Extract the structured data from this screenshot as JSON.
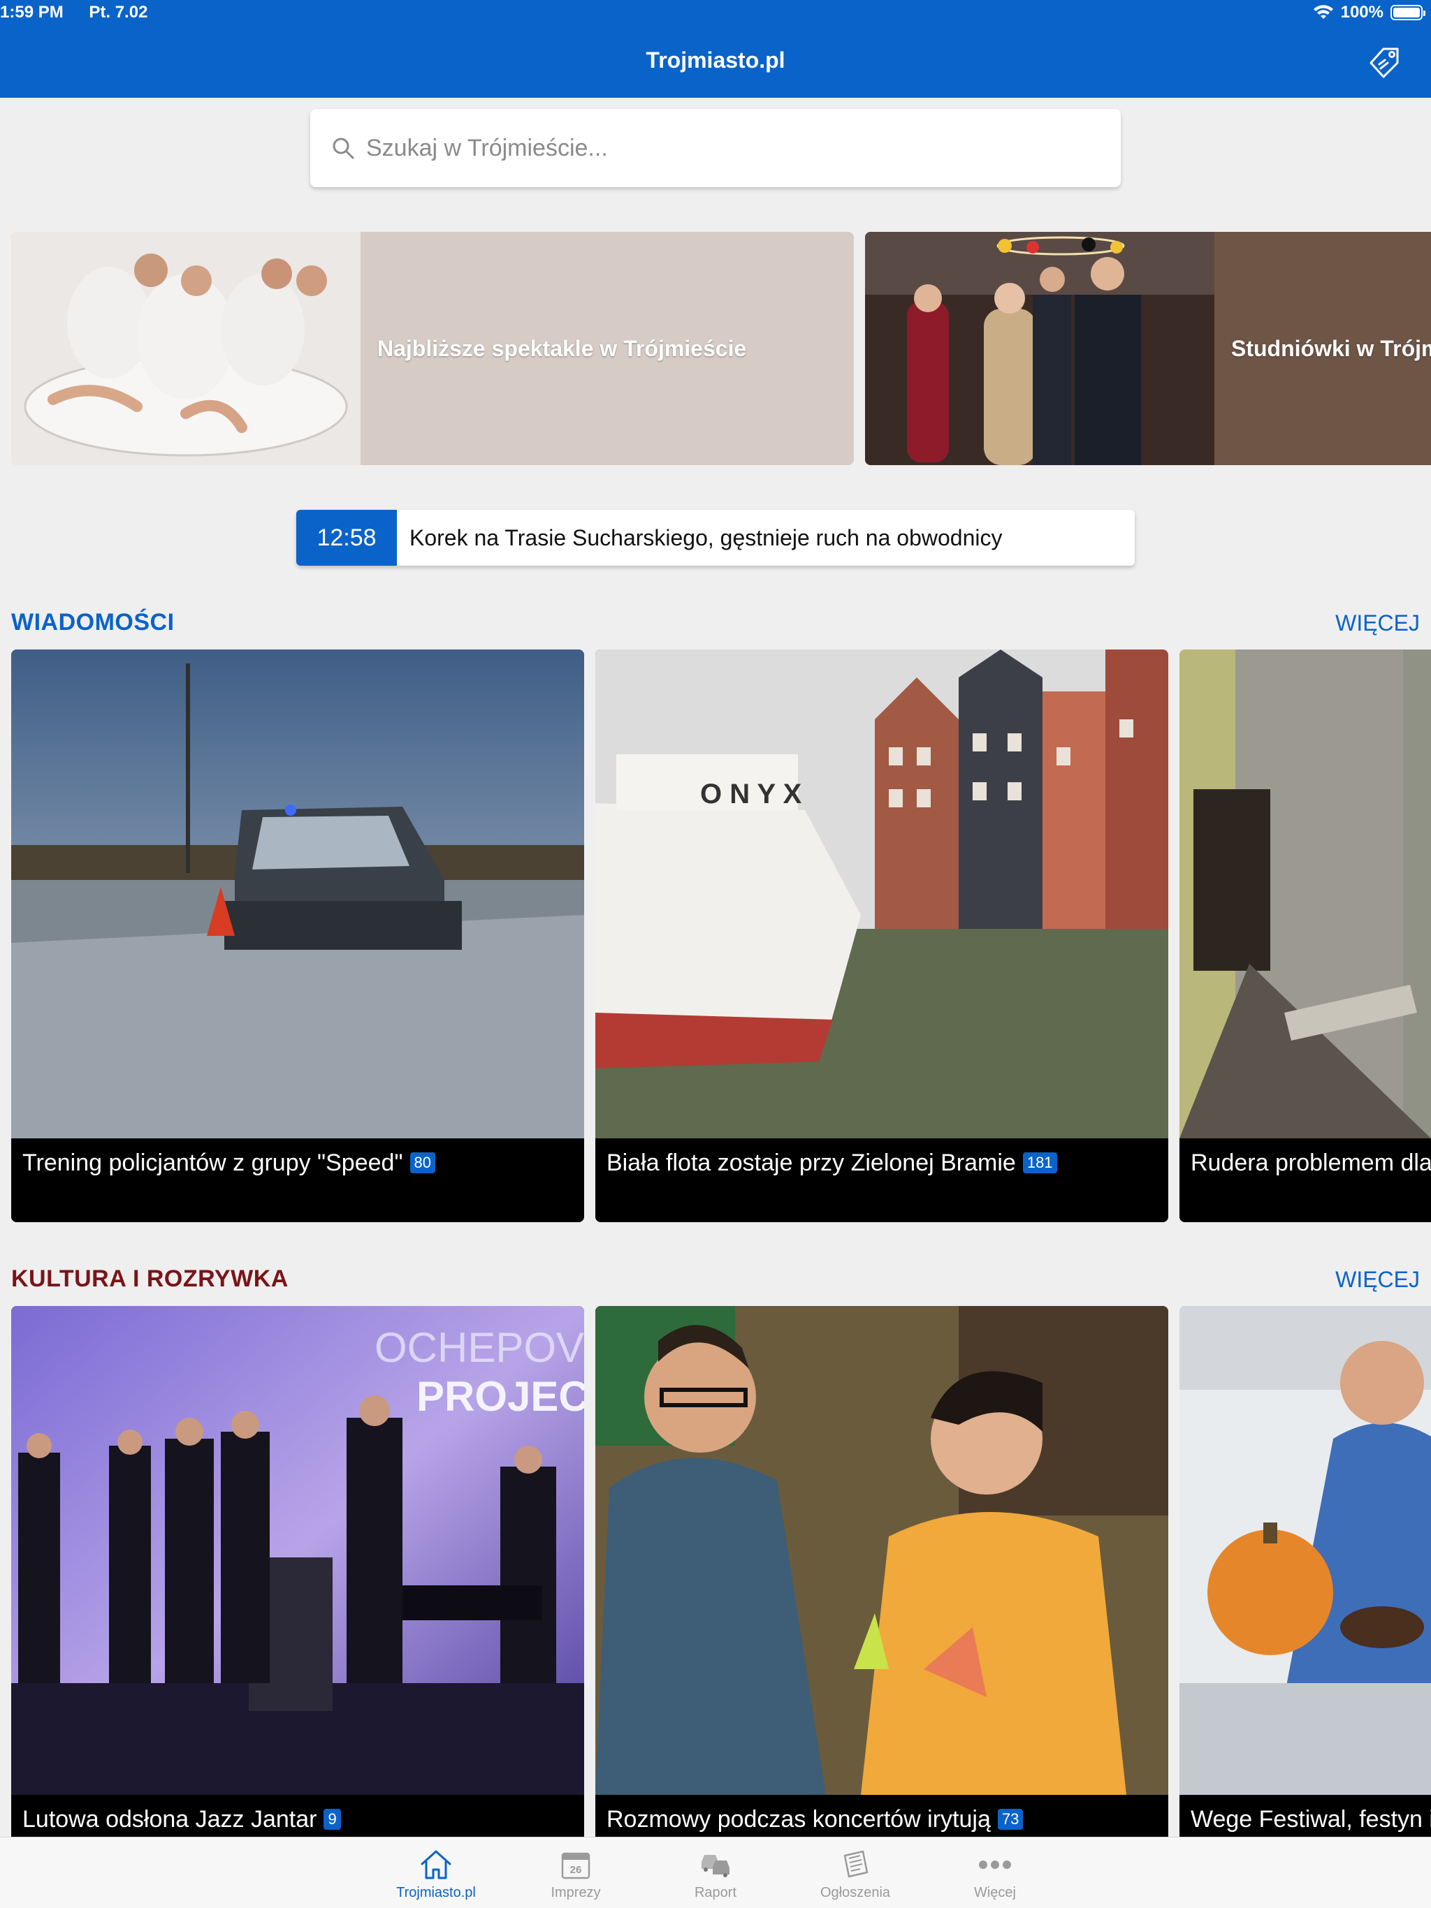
{
  "status_bar": {
    "time": "1:59 PM",
    "date": "Pt. 7.02",
    "battery": "100%",
    "battery_level": 1.0
  },
  "header": {
    "title": "Trojmiasto.pl",
    "action_icon": "tag-icon"
  },
  "search": {
    "placeholder": "Szukaj w Trójmieście..."
  },
  "promos": [
    {
      "label": "Najbliższe spektakle w Trójmieście",
      "bg": "#d6cbc5"
    },
    {
      "label": "Studniówki w Trójmieście",
      "bg": "#6e5546"
    }
  ],
  "ticker": {
    "time": "12:58",
    "message": "Korek na Trasie Sucharskiego, gęstnieje ruch na obwodnicy"
  },
  "news": {
    "title": "WIADOMOŚCI",
    "title_color": "#0a63c9",
    "more": "WIĘCEJ",
    "items": [
      {
        "caption": "Trening policjantów z grupy \"Speed\"",
        "comments": "80"
      },
      {
        "caption": "Biała flota zostaje przy Zielonej Bramie",
        "comments": "181"
      },
      {
        "caption": "Rudera problemem dla mie",
        "comments": ""
      }
    ]
  },
  "culture": {
    "title": "KULTURA I ROZRYWKA",
    "title_color": "#7a1418",
    "more": "WIĘCEJ",
    "items": [
      {
        "caption": "Lutowa odsłona Jazz Jantar",
        "comments": "9"
      },
      {
        "caption": "Rozmowy podczas koncertów irytują",
        "comments": "73"
      },
      {
        "caption": "Wege Festiwal, festyn i uroc",
        "comments": ""
      }
    ]
  },
  "tabbar": {
    "items": [
      {
        "label": "Trojmiasto.pl",
        "icon": "home-icon",
        "active": true
      },
      {
        "label": "Imprezy",
        "icon": "calendar-icon",
        "badge_text": "26"
      },
      {
        "label": "Raport",
        "icon": "cars-icon"
      },
      {
        "label": "Ogłoszenia",
        "icon": "newspaper-icon"
      },
      {
        "label": "Więcej",
        "icon": "more-icon"
      }
    ]
  }
}
